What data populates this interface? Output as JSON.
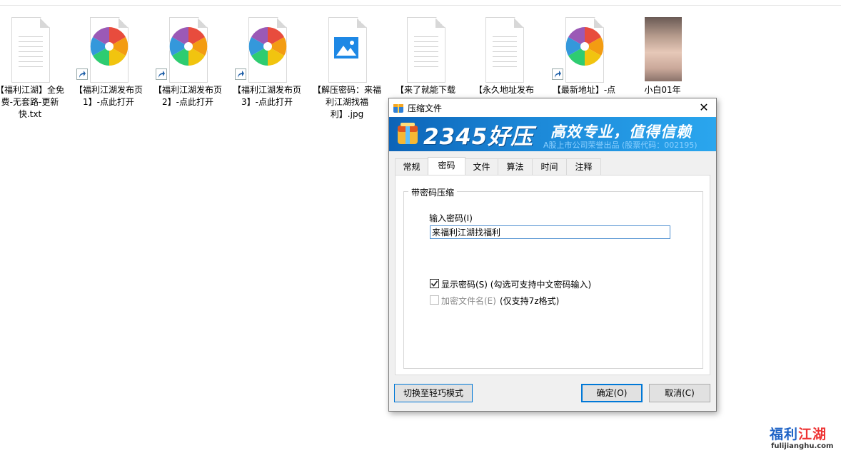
{
  "desktop": {
    "icons": [
      {
        "label": "【福利江湖】全免费-无套路-更新快.txt",
        "kind": "text"
      },
      {
        "label": "【福利江湖发布页1】-点此打开",
        "kind": "shortcut"
      },
      {
        "label": "【福利江湖发布页2】-点此打开",
        "kind": "shortcut"
      },
      {
        "label": "【福利江湖发布页3】-点此打开",
        "kind": "shortcut"
      },
      {
        "label": "【解压密码：来福利江湖找福利】.jpg",
        "kind": "image"
      },
      {
        "label": "【来了就能下载",
        "kind": "text"
      },
      {
        "label": "【永久地址发布",
        "kind": "text"
      },
      {
        "label": "【最新地址】-点",
        "kind": "shortcut"
      },
      {
        "label": "小白01年",
        "kind": "photo"
      }
    ]
  },
  "dialog": {
    "title": "压缩文件",
    "close_glyph": "✕",
    "banner": {
      "logo": "2345好压",
      "slogan": "高效专业，值得信赖",
      "subtitle": "A股上市公司荣誉出品 (股票代码：002195)"
    },
    "tabs": [
      "常规",
      "密码",
      "文件",
      "算法",
      "时间",
      "注释"
    ],
    "active_tab": "密码",
    "group_title": "带密码压缩",
    "password_label": "输入密码(I)",
    "password_value": "来福利江湖找福利",
    "show_password": {
      "label": "显示密码(S) (勾选可支持中文密码输入)",
      "checked": true
    },
    "encrypt_names": {
      "label": "加密文件名(E)",
      "note": "(仅支持7z格式)",
      "checked": false,
      "disabled": true
    },
    "buttons": {
      "switch_mode": "切换至轻巧模式",
      "ok": "确定(O)",
      "cancel": "取消(C)"
    }
  },
  "watermark": {
    "title_part1": "福利",
    "title_part2": "江湖",
    "url": "fulijianghu.com"
  },
  "colors": {
    "banner_start": "#0c63b7",
    "banner_end": "#2aa6ee",
    "focus_blue": "#0078d7"
  }
}
